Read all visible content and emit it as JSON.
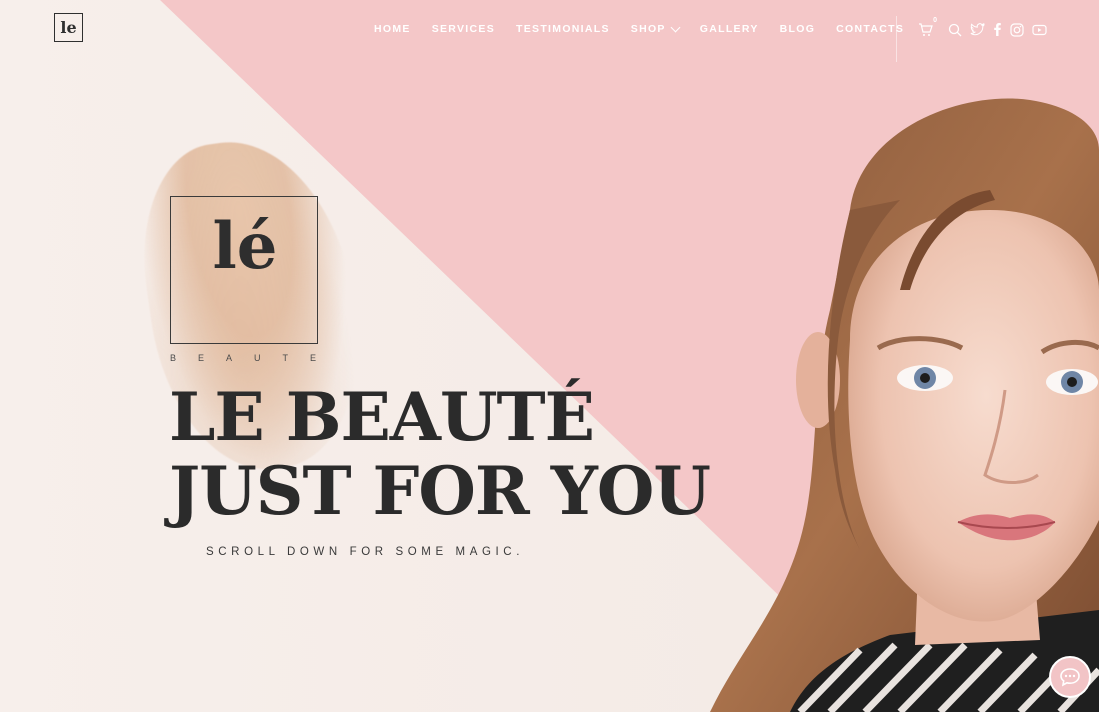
{
  "header": {
    "logo_text": "le",
    "nav": [
      {
        "label": "HOME"
      },
      {
        "label": "SERVICES"
      },
      {
        "label": "TESTIMONIALS"
      },
      {
        "label": "SHOP"
      },
      {
        "label": "GALLERY"
      },
      {
        "label": "BLOG"
      },
      {
        "label": "CONTACTS"
      }
    ],
    "cart_count": "0",
    "icons": [
      "cart-icon",
      "search-icon",
      "twitter-icon",
      "facebook-icon",
      "instagram-icon",
      "youtube-icon"
    ]
  },
  "hero": {
    "brand_mark": "lé",
    "brand_sub": "BEAUTE",
    "headline_line1": "LE BEAUTÉ",
    "headline_line2": "JUST FOR YOU",
    "tagline": "SCROLL DOWN FOR SOME MAGIC."
  },
  "colors": {
    "pink": "#f4c7c8",
    "cream": "#f5ebe6",
    "text_dark": "#2b2b2b"
  }
}
